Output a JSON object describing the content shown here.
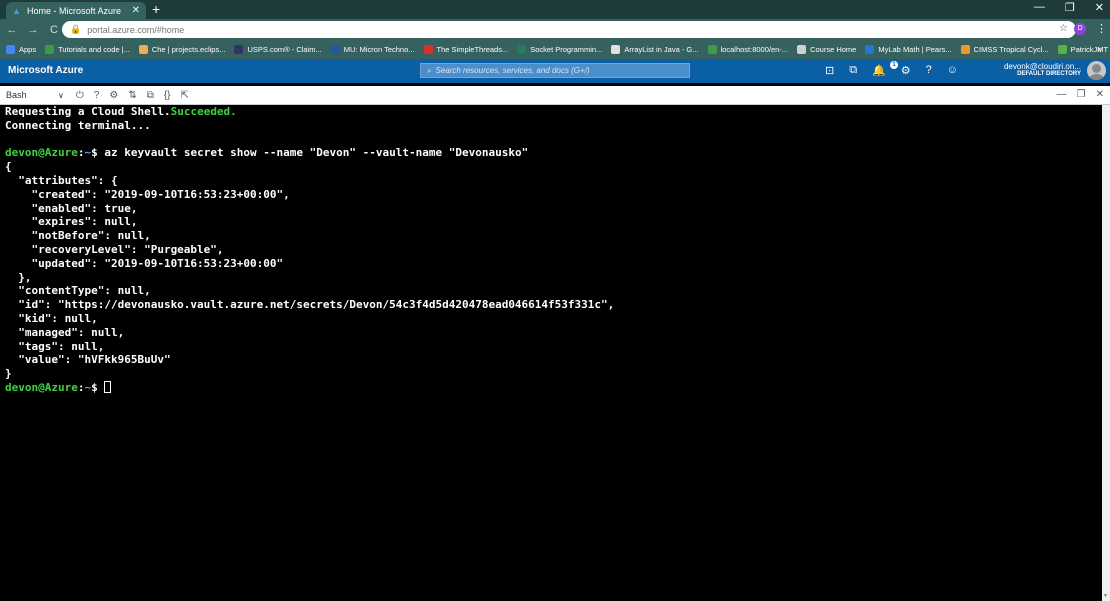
{
  "browser": {
    "tab_title": "Home - Microsoft Azure",
    "url": "portal.azure.com/#home",
    "profile_initial": "D",
    "bookmarks": [
      {
        "label": "Apps",
        "color": "#4285f4"
      },
      {
        "label": "Tutorials and code |...",
        "color": "#3b9b4b"
      },
      {
        "label": "Che | projects.eclips...",
        "color": "#f0ad4e"
      },
      {
        "label": "USPS.com® - Claim...",
        "color": "#333366"
      },
      {
        "label": "MU: Micron Techno...",
        "color": "#1c5aa6"
      },
      {
        "label": "The SimpleThreads...",
        "color": "#d9302c"
      },
      {
        "label": "Socket Programmin...",
        "color": "#2a7a62"
      },
      {
        "label": "ArrayList in Java - G...",
        "color": "#e0e0e0"
      },
      {
        "label": "localhost:8000/en-...",
        "color": "#3b9b4b"
      },
      {
        "label": "Course Home",
        "color": "#cfcfcf"
      },
      {
        "label": "MyLab Math | Pears...",
        "color": "#1c7bd6"
      },
      {
        "label": "CIMSS Tropical Cycl...",
        "color": "#e89b2c"
      },
      {
        "label": "PatrickJMT",
        "color": "#5ab14b"
      }
    ]
  },
  "azure": {
    "brand": "Microsoft Azure",
    "search_placeholder": "Search resources, services, and docs (G+/)",
    "notification_count": "1",
    "user_name": "devonk@cloudiri.on...",
    "directory": "DEFAULT DIRECTORY"
  },
  "shell": {
    "type": "Bash"
  },
  "terminal": {
    "lines": [
      {
        "parts": [
          {
            "t": "Requesting a Cloud Shell.",
            "c": ""
          },
          {
            "t": "Succeeded.",
            "c": "green"
          }
        ]
      },
      {
        "parts": [
          {
            "t": "Connecting terminal...",
            "c": ""
          }
        ]
      },
      {
        "parts": [
          {
            "t": "",
            "c": ""
          }
        ]
      },
      {
        "parts": [
          {
            "t": "devon@Azure",
            "c": "green"
          },
          {
            "t": ":",
            "c": ""
          },
          {
            "t": "~",
            "c": "blue"
          },
          {
            "t": "$ az keyvault secret show --name \"Devon\" --vault-name \"Devonausko\"",
            "c": ""
          }
        ]
      },
      {
        "parts": [
          {
            "t": "{",
            "c": ""
          }
        ]
      },
      {
        "parts": [
          {
            "t": "  \"attributes\": {",
            "c": ""
          }
        ]
      },
      {
        "parts": [
          {
            "t": "    \"created\": \"2019-09-10T16:53:23+00:00\",",
            "c": ""
          }
        ]
      },
      {
        "parts": [
          {
            "t": "    \"enabled\": true,",
            "c": ""
          }
        ]
      },
      {
        "parts": [
          {
            "t": "    \"expires\": null,",
            "c": ""
          }
        ]
      },
      {
        "parts": [
          {
            "t": "    \"notBefore\": null,",
            "c": ""
          }
        ]
      },
      {
        "parts": [
          {
            "t": "    \"recoveryLevel\": \"Purgeable\",",
            "c": ""
          }
        ]
      },
      {
        "parts": [
          {
            "t": "    \"updated\": \"2019-09-10T16:53:23+00:00\"",
            "c": ""
          }
        ]
      },
      {
        "parts": [
          {
            "t": "  },",
            "c": ""
          }
        ]
      },
      {
        "parts": [
          {
            "t": "  \"contentType\": null,",
            "c": ""
          }
        ]
      },
      {
        "parts": [
          {
            "t": "  \"id\": \"https://devonausko.vault.azure.net/secrets/Devon/54c3f4d5d420478ead046614f53f331c\",",
            "c": ""
          }
        ]
      },
      {
        "parts": [
          {
            "t": "  \"kid\": null,",
            "c": ""
          }
        ]
      },
      {
        "parts": [
          {
            "t": "  \"managed\": null,",
            "c": ""
          }
        ]
      },
      {
        "parts": [
          {
            "t": "  \"tags\": null,",
            "c": ""
          }
        ]
      },
      {
        "parts": [
          {
            "t": "  \"value\": \"hVFkk965BuUv\"",
            "c": ""
          }
        ]
      },
      {
        "parts": [
          {
            "t": "}",
            "c": ""
          }
        ]
      },
      {
        "parts": [
          {
            "t": "devon@Azure",
            "c": "green"
          },
          {
            "t": ":",
            "c": ""
          },
          {
            "t": "~",
            "c": "blue"
          },
          {
            "t": "$ ",
            "c": ""
          }
        ],
        "cursor": true
      }
    ]
  }
}
